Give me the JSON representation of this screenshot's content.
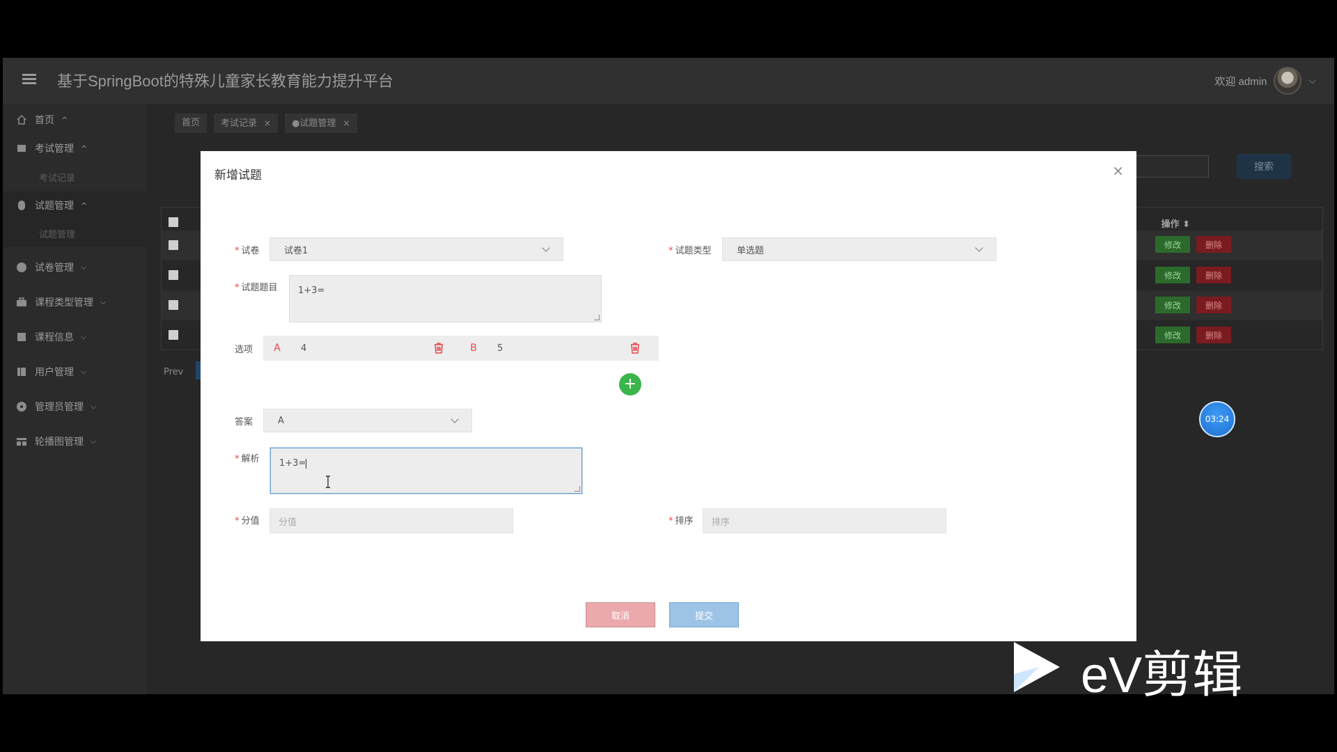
{
  "app": {
    "title": "基于SpringBoot的特殊儿童家长教育能力提升平台",
    "welcome": "欢迎 admin"
  },
  "sidebar": {
    "items": [
      {
        "label": "首页",
        "icon": "home-icon"
      },
      {
        "label": "考试管理",
        "icon": "exam-icon"
      },
      {
        "label": "考试记录",
        "sub": true
      },
      {
        "label": "试题管理",
        "icon": "question-icon"
      },
      {
        "label": "试题管理",
        "sub": true
      },
      {
        "label": "试卷管理",
        "icon": "paper-icon"
      },
      {
        "label": "课程类型管理",
        "icon": "briefcase-icon"
      },
      {
        "label": "课程信息",
        "icon": "book-icon"
      },
      {
        "label": "用户管理",
        "icon": "user-icon"
      },
      {
        "label": "管理员管理",
        "icon": "admin-icon"
      },
      {
        "label": "轮播图管理",
        "icon": "carousel-icon"
      }
    ]
  },
  "tabs": [
    {
      "label": "首页"
    },
    {
      "label": "考试记录",
      "close": "×"
    },
    {
      "label": "●试题管理",
      "close": "×"
    }
  ],
  "toolbar": {
    "search_label": "搜索"
  },
  "table": {
    "op_header": "操作 ⬍",
    "edit_label": "修改",
    "delete_label": "删除"
  },
  "pagination": {
    "prev": "Prev"
  },
  "timer": "03:24",
  "modal": {
    "title": "新增试题",
    "close": "×",
    "fields": {
      "paper_label": "试卷",
      "paper_value": "试卷1",
      "type_label": "试题类型",
      "type_value": "单选题",
      "question_label": "试题题目",
      "question_value": "1+3=",
      "options_label": "选项",
      "options": [
        {
          "letter": "A",
          "value": "4"
        },
        {
          "letter": "B",
          "value": "5"
        }
      ],
      "add_option": "+",
      "answer_label": "答案",
      "answer_value": "A",
      "analysis_label": "解析",
      "analysis_value": "1+3=",
      "score_label": "分值",
      "score_placeholder": "分值",
      "order_label": "排序",
      "order_placeholder": "排序",
      "required_mark": "*"
    },
    "buttons": {
      "cancel": "取消",
      "submit": "提交"
    }
  },
  "watermark": {
    "text": "eV剪辑"
  }
}
